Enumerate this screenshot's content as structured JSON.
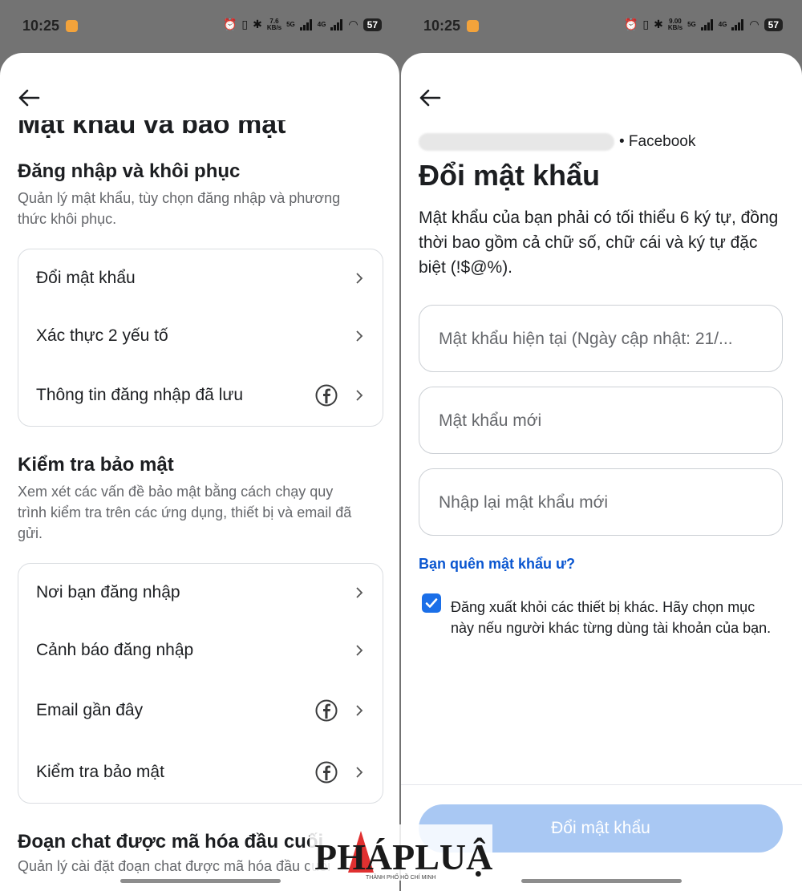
{
  "left": {
    "status": {
      "time": "10:25",
      "speed": "7.6\nKB/s",
      "battery": "57",
      "net1": "5G",
      "net2": "4G"
    },
    "header_partial": "Mật khẩu và bảo mật",
    "login": {
      "title": "Đăng nhập và khôi phục",
      "desc": "Quản lý mật khẩu, tùy chọn đăng nhập và phương thức khôi phục.",
      "items": [
        {
          "label": "Đổi mật khẩu"
        },
        {
          "label": "Xác thực 2 yếu tố"
        },
        {
          "label": "Thông tin đăng nhập đã lưu",
          "icon": "facebook-icon"
        }
      ]
    },
    "security": {
      "title": "Kiểm tra bảo mật",
      "desc": "Xem xét các vấn đề bảo mật bằng cách chạy quy trình kiểm tra trên các ứng dụng, thiết bị và email đã gửi.",
      "items": [
        {
          "label": "Nơi bạn đăng nhập"
        },
        {
          "label": "Cảnh báo đăng nhập"
        },
        {
          "label": "Email gần đây",
          "icon": "facebook-icon"
        },
        {
          "label": "Kiểm tra bảo mật",
          "icon": "facebook-icon"
        }
      ]
    },
    "encrypted": {
      "title": "Đoạn chat được mã hóa đầu cuối",
      "desc": "Quản lý cài đặt đoạn chat được mã hóa đầu cuối"
    }
  },
  "right": {
    "status": {
      "time": "10:25",
      "speed": "9.00\nKB/s",
      "battery": "57",
      "net1": "5G",
      "net2": "4G"
    },
    "account_suffix": "• Facebook",
    "title": "Đổi mật khẩu",
    "requirements": "Mật khẩu của bạn phải có tối thiểu 6 ký tự, đồng thời bao gồm cả chữ số, chữ cái và ký tự đặc biệt (!$@%).",
    "fields": {
      "current_placeholder": "Mật khẩu hiện tại (Ngày cập nhật: 21/...",
      "new_placeholder": "Mật khẩu mới",
      "confirm_placeholder": "Nhập lại mật khẩu mới"
    },
    "forgot_link": "Bạn quên mật khẩu ư?",
    "logout_others": {
      "checked": true,
      "text": "Đăng xuất khỏi các thiết bị khác. Hãy chọn mục này nếu người khác từng dùng tài khoản của bạn."
    },
    "submit_label": "Đổi mật khẩu"
  },
  "watermark": {
    "brand": "PHÁPLUẬT",
    "sub": "THÀNH PHỐ HỒ CHÍ MINH"
  },
  "colors": {
    "accent": "#1b6fe8",
    "link": "#0a56d0",
    "button_disabled": "#a9c8f3",
    "watermark_red": "#e03030"
  }
}
